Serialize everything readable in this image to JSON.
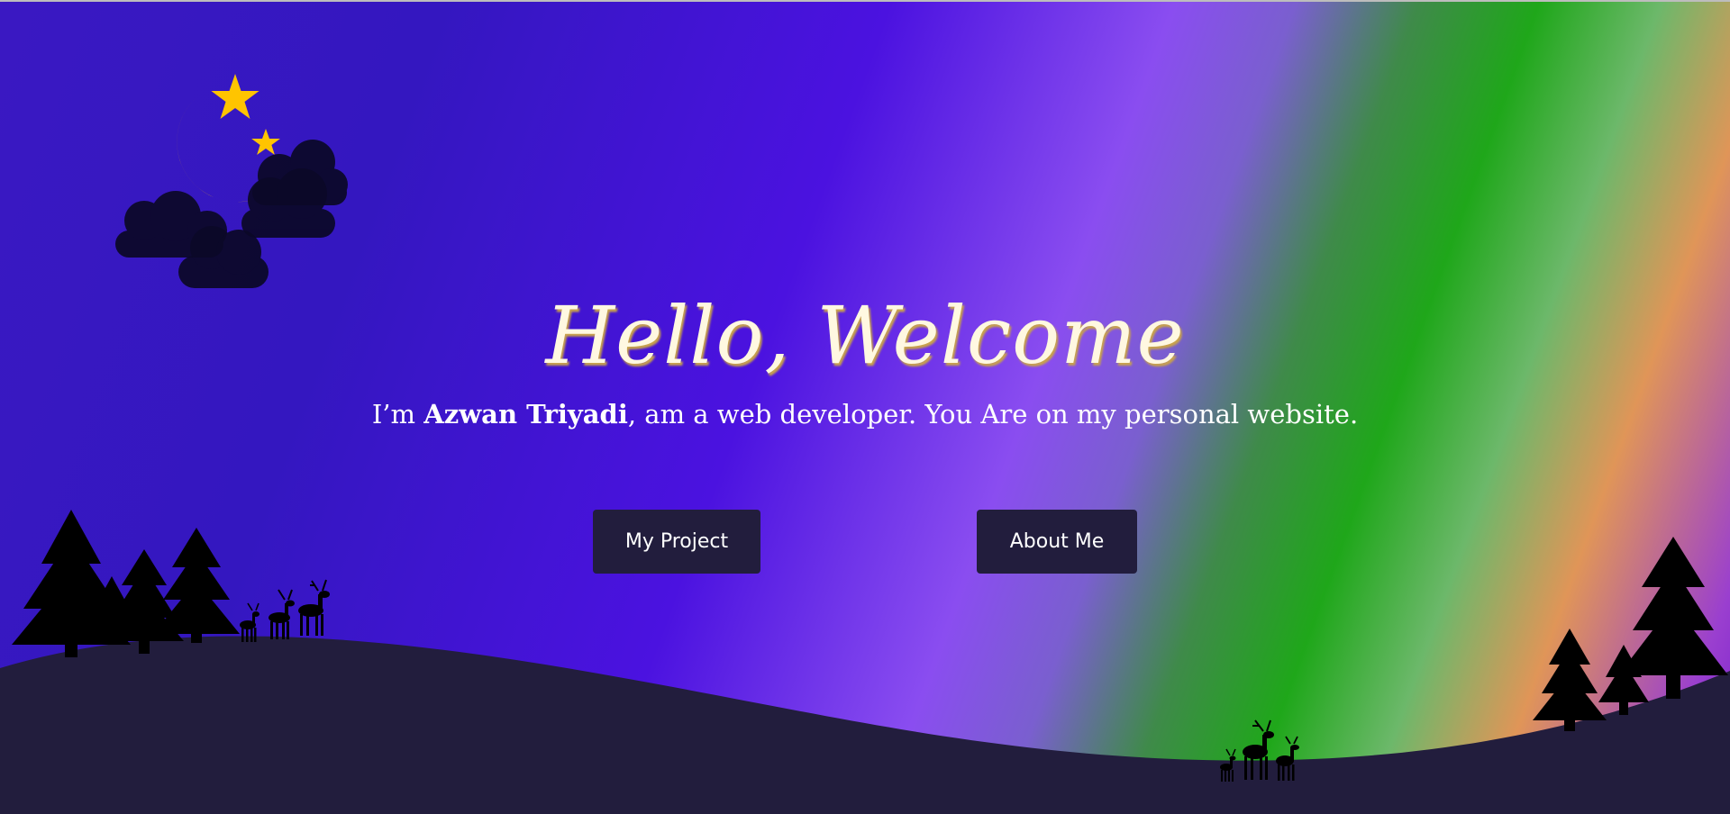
{
  "hero": {
    "title": "Hello, Welcome",
    "intro_prefix": "I’m ",
    "name": "Azwan Triyadi",
    "intro_suffix": ", am a web developer. You Are on my personal website."
  },
  "buttons": {
    "project_label": "My Project",
    "about_label": "About Me"
  },
  "colors": {
    "hill": "#221d3d",
    "moon": "#ffc400",
    "button_bg": "#221d3d",
    "title_text": "#fff8e1"
  },
  "icons": [
    "moon-icon",
    "star-icon",
    "cloud-icon",
    "tree-icon",
    "deer-icon"
  ]
}
